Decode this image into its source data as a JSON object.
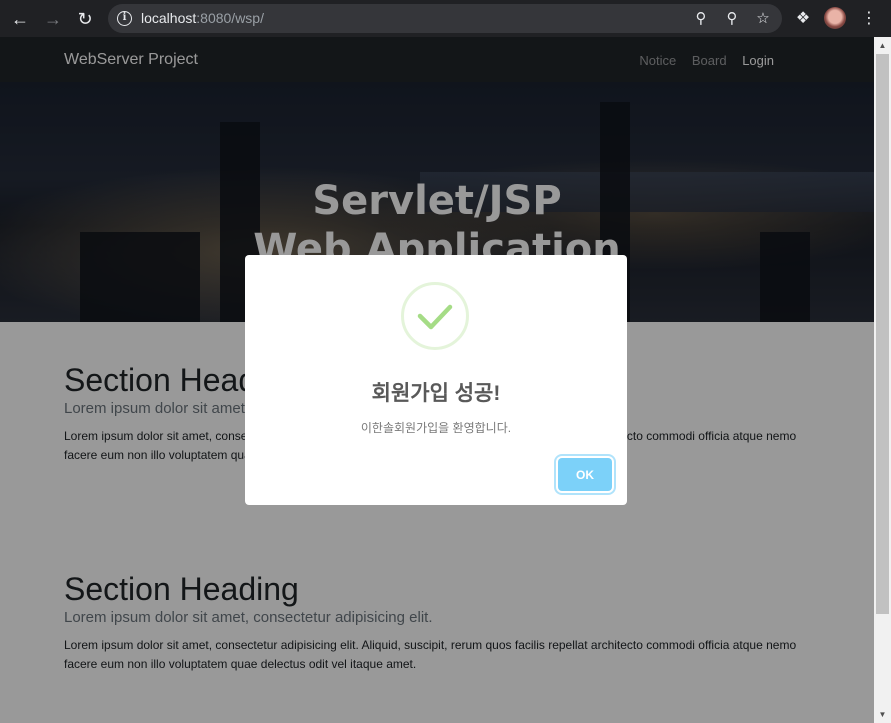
{
  "browser": {
    "url_host": "localhost",
    "url_rest": ":8080/wsp/",
    "icons": [
      "back-arrow-icon",
      "forward-arrow-icon",
      "reload-icon",
      "info-icon",
      "key-icon",
      "zoom-icon",
      "star-icon",
      "extensions-icon",
      "profile-avatar",
      "menu-icon"
    ]
  },
  "site": {
    "brand": "WebServer Project",
    "nav": {
      "notice": "Notice",
      "board": "Board",
      "login": "Login"
    }
  },
  "hero": {
    "line1": "Servlet/JSP",
    "line2": "Web Application"
  },
  "sections": [
    {
      "heading": "Section Heading",
      "lead": "Lorem ipsum dolor sit amet, consectetur adipisicing elit.",
      "body": "Lorem ipsum dolor sit amet, consectetur adipisicing elit. Aliquid, suscipit, rerum quos facilis repellat architecto commodi officia atque nemo facere eum non illo voluptatem quae delectus odit vel itaque amet."
    },
    {
      "heading": "Section Heading",
      "lead": "Lorem ipsum dolor sit amet, consectetur adipisicing elit.",
      "body": "Lorem ipsum dolor sit amet, consectetur adipisicing elit. Aliquid, suscipit, rerum quos facilis repellat architecto commodi officia atque nemo facere eum non illo voluptatem quae delectus odit vel itaque amet."
    }
  ],
  "modal": {
    "title": "회원가입 성공!",
    "text": "이한솔회원가입을 환영합니다.",
    "ok_label": "OK",
    "success_color": "#a5dc86",
    "button_color": "#7cd1f9"
  }
}
